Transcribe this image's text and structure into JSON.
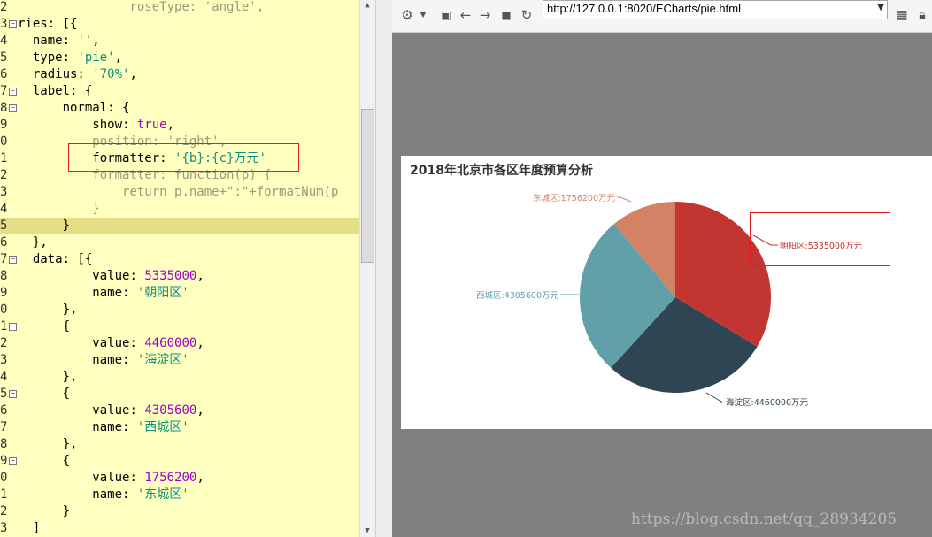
{
  "editor": {
    "lines": [
      {
        "no": "2",
        "fold": "",
        "indent": 15,
        "parts": [
          [
            "cm",
            "roseType: 'angle',"
          ]
        ]
      },
      {
        "no": "3",
        "fold": "⊟",
        "indent": 0,
        "parts": [
          [
            "kw",
            "ries: [{"
          ]
        ]
      },
      {
        "no": "4",
        "fold": "",
        "indent": 2,
        "parts": [
          [
            "kw",
            "name: "
          ],
          [
            "str",
            "''"
          ],
          [
            "kw",
            ","
          ]
        ]
      },
      {
        "no": "5",
        "fold": "",
        "indent": 2,
        "parts": [
          [
            "kw",
            "type: "
          ],
          [
            "str",
            "'pie'"
          ],
          [
            "kw",
            ","
          ]
        ]
      },
      {
        "no": "6",
        "fold": "",
        "indent": 2,
        "parts": [
          [
            "kw",
            "radius: "
          ],
          [
            "str",
            "'70%'"
          ],
          [
            "kw",
            ","
          ]
        ]
      },
      {
        "no": "7",
        "fold": "⊟",
        "indent": 2,
        "parts": [
          [
            "kw",
            "label: {"
          ]
        ]
      },
      {
        "no": "8",
        "fold": "⊟",
        "indent": 6,
        "parts": [
          [
            "kw",
            "normal: {"
          ]
        ]
      },
      {
        "no": "9",
        "fold": "",
        "indent": 10,
        "parts": [
          [
            "kw",
            "show: "
          ],
          [
            "bool",
            "true"
          ],
          [
            "kw",
            ","
          ]
        ]
      },
      {
        "no": "0",
        "fold": "",
        "indent": 10,
        "parts": [
          [
            "cm",
            "position: 'right',"
          ]
        ]
      },
      {
        "no": "1",
        "fold": "",
        "indent": 10,
        "parts": [
          [
            "kw",
            "formatter: "
          ],
          [
            "str",
            "'{b}:{c}万元'"
          ]
        ]
      },
      {
        "no": "2",
        "fold": "",
        "indent": 10,
        "parts": [
          [
            "cm",
            "formatter: function(p) {"
          ]
        ]
      },
      {
        "no": "3",
        "fold": "",
        "indent": 14,
        "parts": [
          [
            "cm",
            "return p.name+\":\"+formatNum(p"
          ]
        ]
      },
      {
        "no": "4",
        "fold": "",
        "indent": 10,
        "parts": [
          [
            "cm",
            "}"
          ]
        ]
      },
      {
        "no": "5",
        "fold": "",
        "indent": 6,
        "parts": [
          [
            "kw",
            "}"
          ]
        ],
        "hl": true
      },
      {
        "no": "6",
        "fold": "",
        "indent": 2,
        "parts": [
          [
            "kw",
            "},"
          ]
        ]
      },
      {
        "no": "7",
        "fold": "⊟",
        "indent": 2,
        "parts": [
          [
            "kw",
            "data: [{"
          ]
        ]
      },
      {
        "no": "8",
        "fold": "",
        "indent": 10,
        "parts": [
          [
            "kw",
            "value: "
          ],
          [
            "num",
            "5335000"
          ],
          [
            "kw",
            ","
          ]
        ]
      },
      {
        "no": "9",
        "fold": "",
        "indent": 10,
        "parts": [
          [
            "kw",
            "name: "
          ],
          [
            "str",
            "'朝阳区'"
          ]
        ]
      },
      {
        "no": "0",
        "fold": "",
        "indent": 6,
        "parts": [
          [
            "kw",
            "},"
          ]
        ]
      },
      {
        "no": "1",
        "fold": "⊟",
        "indent": 6,
        "parts": [
          [
            "kw",
            "{"
          ]
        ]
      },
      {
        "no": "2",
        "fold": "",
        "indent": 10,
        "parts": [
          [
            "kw",
            "value: "
          ],
          [
            "num",
            "4460000"
          ],
          [
            "kw",
            ","
          ]
        ]
      },
      {
        "no": "3",
        "fold": "",
        "indent": 10,
        "parts": [
          [
            "kw",
            "name: "
          ],
          [
            "str",
            "'海淀区'"
          ]
        ]
      },
      {
        "no": "4",
        "fold": "",
        "indent": 6,
        "parts": [
          [
            "kw",
            "},"
          ]
        ]
      },
      {
        "no": "5",
        "fold": "⊟",
        "indent": 6,
        "parts": [
          [
            "kw",
            "{"
          ]
        ]
      },
      {
        "no": "6",
        "fold": "",
        "indent": 10,
        "parts": [
          [
            "kw",
            "value: "
          ],
          [
            "num",
            "4305600"
          ],
          [
            "kw",
            ","
          ]
        ]
      },
      {
        "no": "7",
        "fold": "",
        "indent": 10,
        "parts": [
          [
            "kw",
            "name: "
          ],
          [
            "str",
            "'西城区'"
          ]
        ]
      },
      {
        "no": "8",
        "fold": "",
        "indent": 6,
        "parts": [
          [
            "kw",
            "},"
          ]
        ]
      },
      {
        "no": "9",
        "fold": "⊟",
        "indent": 6,
        "parts": [
          [
            "kw",
            "{"
          ]
        ]
      },
      {
        "no": "0",
        "fold": "",
        "indent": 10,
        "parts": [
          [
            "kw",
            "value: "
          ],
          [
            "num",
            "1756200"
          ],
          [
            "kw",
            ","
          ]
        ]
      },
      {
        "no": "1",
        "fold": "",
        "indent": 10,
        "parts": [
          [
            "kw",
            "name: "
          ],
          [
            "str",
            "'东城区'"
          ]
        ]
      },
      {
        "no": "2",
        "fold": "",
        "indent": 6,
        "parts": [
          [
            "kw",
            "}"
          ]
        ]
      },
      {
        "no": "3",
        "fold": "",
        "indent": 2,
        "parts": [
          [
            "kw",
            "]"
          ]
        ]
      }
    ]
  },
  "browser": {
    "url": "http://127.0.0.1:8020/ECharts/pie.html",
    "toolbar_icons": [
      "gear-icon",
      "dropdown-icon",
      "terminal-icon",
      "back-icon",
      "forward-icon",
      "stop-icon",
      "reload-icon"
    ],
    "right_icons": [
      "qr-code-icon",
      "lock-icon"
    ]
  },
  "chart_data": {
    "type": "pie",
    "title": "2018年北京市各区年度预算分析",
    "slices": [
      {
        "name": "朝阳区",
        "value": 5335000,
        "label": "朝阳区:5335000万元",
        "color": "#c23531"
      },
      {
        "name": "海淀区",
        "value": 4460000,
        "label": "海淀区:4460000万元",
        "color": "#2f4554"
      },
      {
        "name": "西城区",
        "value": 4305600,
        "label": "西城区:4305600万元",
        "color": "#61a0a8"
      },
      {
        "name": "东城区",
        "value": 1756200,
        "label": "东城区:1756200万元",
        "color": "#d48265"
      }
    ]
  },
  "watermark": "https://blog.csdn.net/qq_28934205"
}
